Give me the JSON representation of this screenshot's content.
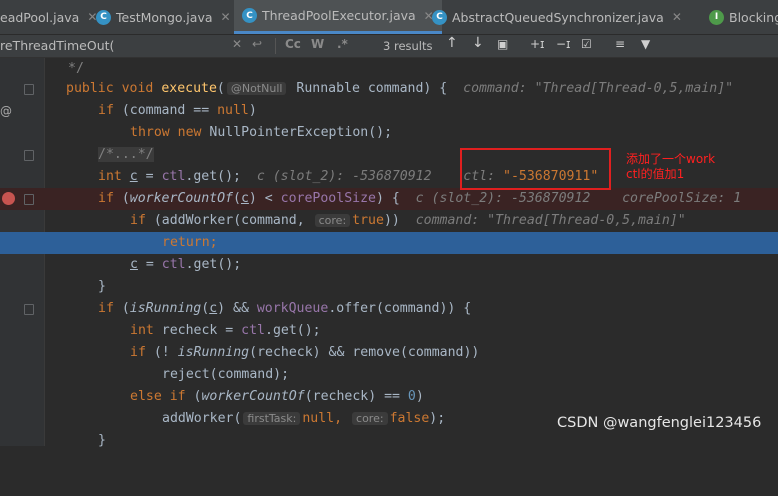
{
  "tabs": [
    {
      "label": "eadPool.java",
      "active": false,
      "icon": "class-icon"
    },
    {
      "label": "TestMongo.java",
      "active": false,
      "icon": "class-icon"
    },
    {
      "label": "ThreadPoolExecutor.java",
      "active": true,
      "icon": "class-icon"
    },
    {
      "label": "AbstractQueuedSynchronizer.java",
      "active": false,
      "icon": "class-icon"
    },
    {
      "label": "BlockingQueu",
      "active": false,
      "icon": "interface-icon"
    }
  ],
  "search": {
    "query": "reThreadTimeOut(",
    "results": "3 results",
    "match_case": "Cc",
    "words": "W",
    "regex": ".*"
  },
  "code": {
    "l1_comment": "*/",
    "l2_public": "public",
    "l2_void": "void",
    "l2_name": "execute",
    "l2_open": "(",
    "l2_annotation": "@NotNull",
    "l2_rest": " Runnable command) {",
    "l2_dbg": "command: \"Thread[Thread-0,5,main]\"",
    "l3_if": "if",
    "l3_a": " (command == ",
    "l3_null": "null",
    "l3_b": ")",
    "l4_throw": "throw",
    "l4_new": "new",
    "l4_rest": " NullPointerException();",
    "l5_fold": "/*...*/",
    "l6_int": "int",
    "l6_c": "c",
    "l6_eq": " = ",
    "l6_ctl": "ctl",
    "l6_get": ".get();",
    "l6_dbg": "c (slot_2): -536870912",
    "l6_dbg2_prefix": "ctl: ",
    "l6_dbg2_value": "\"-536870911\"",
    "l7_if": "if",
    "l7_a": " (",
    "l7_wc": "workerCountOf",
    "l7_b": "(",
    "l7_c": "c",
    "l7_d": ") < ",
    "l7_core": "corePoolSize",
    "l7_e": ") {",
    "l7_dbg": "c (slot_2): -536870912",
    "l7_dbg2": "corePoolSize: 1",
    "l8_if": "if",
    "l8_a": " (addWorker(command, ",
    "l8_hint": "core:",
    "l8_true": "true",
    "l8_b": "))",
    "l8_dbg": "command: \"Thread[Thread-0,5,main]\"",
    "l9_return": "return;",
    "l10_c": "c",
    "l10_a": " = ",
    "l10_ctl": "ctl",
    "l10_b": ".get();",
    "l11": "}",
    "l12_if": "if",
    "l12_a": " (",
    "l12_ir": "isRunning",
    "l12_b": "(",
    "l12_c": "c",
    "l12_d": ") && ",
    "l12_wq": "workQueue",
    "l12_e": ".offer(command)) {",
    "l13_int": "int",
    "l13_a": " recheck = ",
    "l13_ctl": "ctl",
    "l13_b": ".get();",
    "l14_if": "if",
    "l14_a": " (! ",
    "l14_ir": "isRunning",
    "l14_b": "(recheck) && remove(command))",
    "l15": "reject(command);",
    "l16_else": "else if",
    "l16_a": " (",
    "l16_wc": "workerCountOf",
    "l16_b": "(recheck) == ",
    "l16_zero": "0",
    "l16_c": ")",
    "l17_a": "addWorker(",
    "l17_hint1": "firstTask:",
    "l17_null": "null",
    "l17_comma": ",",
    "l17_hint2": "core:",
    "l17_false": "false",
    "l17_b": ");",
    "l18": "}"
  },
  "annotation": {
    "line1": "添加了一个work",
    "line2": "ctl的值加1"
  },
  "watermark": "CSDN @wangfenglei123456",
  "colors": {
    "keyword": "#cc7832",
    "method": "#ffc66d",
    "field": "#9876aa",
    "exec_line": "#2d6099",
    "breakpoint": "#c75450",
    "annotation_red": "#e01f1f"
  }
}
